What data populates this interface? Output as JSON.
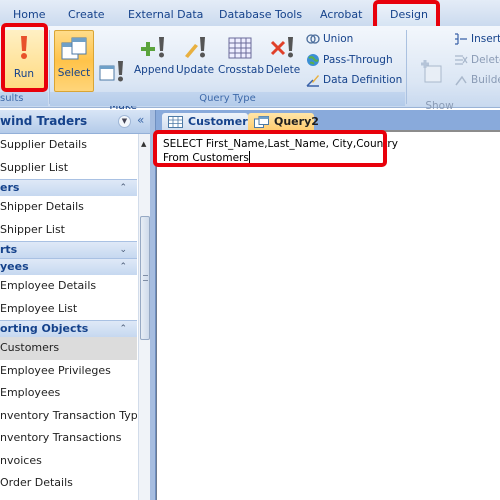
{
  "ribbon_tabs": [
    {
      "label": "Home"
    },
    {
      "label": "Create"
    },
    {
      "label": "External Data"
    },
    {
      "label": "Database Tools"
    },
    {
      "label": "Acrobat"
    },
    {
      "label": "Design",
      "active": true,
      "highlighted": true
    }
  ],
  "groups": {
    "results": {
      "label": "Results",
      "label_visible": "sults",
      "run": {
        "label": "Run",
        "icon": "exclamation-icon",
        "highlighted": true
      }
    },
    "query_type": {
      "label": "Query Type",
      "buttons": [
        {
          "label": "Select",
          "icon": "select-query-icon",
          "active": true
        },
        {
          "label": "Make\nTable",
          "icon": "make-table-icon"
        },
        {
          "label": "Append",
          "icon": "append-icon"
        },
        {
          "label": "Update",
          "icon": "update-icon"
        },
        {
          "label": "Crosstab",
          "icon": "crosstab-icon"
        },
        {
          "label": "Delete",
          "icon": "delete-icon"
        }
      ],
      "small_buttons": [
        {
          "label": "Union",
          "icon": "union-icon"
        },
        {
          "label": "Pass-Through",
          "icon": "globe-icon"
        },
        {
          "label": "Data Definition",
          "icon": "data-definition-icon"
        }
      ]
    },
    "query_setup": {
      "show_table": {
        "label": "Show\nTable",
        "disabled": true
      },
      "small_buttons": [
        {
          "label": "Insert",
          "icon": "insert-rows-icon"
        },
        {
          "label": "Delete",
          "icon": "delete-rows-icon",
          "disabled": true
        },
        {
          "label": "Builder",
          "icon": "builder-icon",
          "disabled": true
        }
      ]
    }
  },
  "nav_pane": {
    "title": "Northwind Traders",
    "title_visible": "wind Traders",
    "items": [
      {
        "type": "item",
        "label": "Supplier Details"
      },
      {
        "type": "item",
        "label": "Supplier List"
      },
      {
        "type": "group",
        "label": "ers",
        "chevron": "up"
      },
      {
        "type": "item",
        "label": "Shipper Details"
      },
      {
        "type": "item",
        "label": "Shipper List"
      },
      {
        "type": "group",
        "label": "rts",
        "chevron": "down"
      },
      {
        "type": "group",
        "label": "yees",
        "chevron": "up"
      },
      {
        "type": "item",
        "label": "Employee Details"
      },
      {
        "type": "item",
        "label": "Employee List"
      },
      {
        "type": "group",
        "label": "orting Objects",
        "chevron": "up"
      },
      {
        "type": "item",
        "label": "Customers",
        "selected": true
      },
      {
        "type": "item",
        "label": "Employee Privileges"
      },
      {
        "type": "item",
        "label": "Employees"
      },
      {
        "type": "item",
        "label": "nventory Transaction Types"
      },
      {
        "type": "item",
        "label": "nventory Transactions"
      },
      {
        "type": "item",
        "label": "nvoices"
      },
      {
        "type": "item",
        "label": "Order Details"
      }
    ]
  },
  "document_tabs": [
    {
      "label": "Customers",
      "icon": "table-icon"
    },
    {
      "label": "Query2",
      "icon": "query-icon",
      "active": true
    }
  ],
  "editor": {
    "sql_line1": "SELECT First_Name,Last_Name, City,Country",
    "sql_line2": "From Customers"
  },
  "colors": {
    "highlight_red": "#e8000b",
    "ribbon_blue": "#15428b",
    "active_orange": "#ffc34a"
  }
}
